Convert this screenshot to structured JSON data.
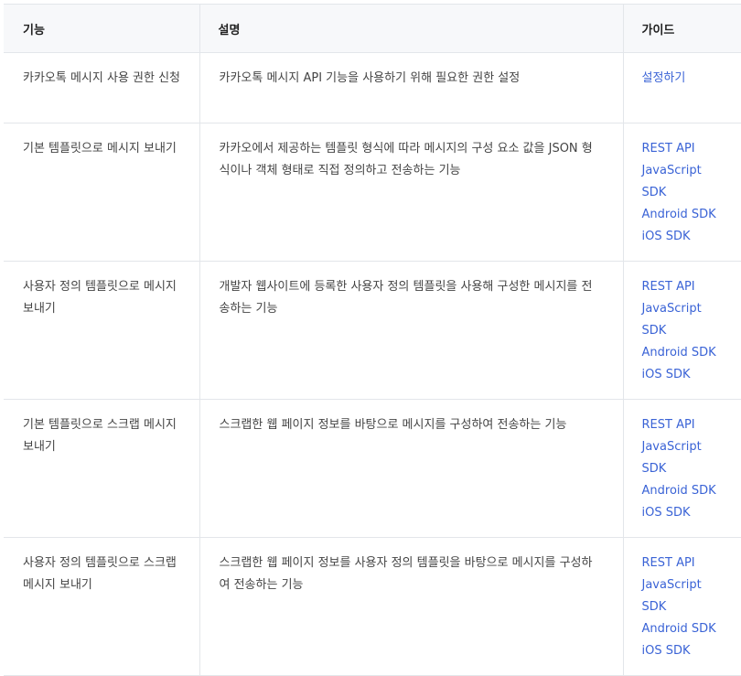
{
  "header": {
    "col1": "기능",
    "col2": "설명",
    "col3": "가이드"
  },
  "rows": [
    {
      "feature": "카카오톡 메시지 사용 권한 신청",
      "description": "카카오톡 메시지 API 기능을 사용하기 위해 필요한 권한 설정",
      "links": [
        "설정하기"
      ]
    },
    {
      "feature": "기본 템플릿으로 메시지 보내기",
      "description": "카카오에서 제공하는 템플릿 형식에 따라 메시지의 구성 요소 값을 JSON 형식이나 객체 형태로 직접 정의하고 전송하는 기능",
      "links": [
        "REST API",
        "JavaScript SDK",
        "Android SDK",
        "iOS SDK"
      ]
    },
    {
      "feature": "사용자 정의 템플릿으로 메시지 보내기",
      "description": "개발자 웹사이트에 등록한 사용자 정의 템플릿을 사용해 구성한 메시지를 전송하는 기능",
      "links": [
        "REST API",
        "JavaScript SDK",
        "Android SDK",
        "iOS SDK"
      ]
    },
    {
      "feature": "기본 템플릿으로 스크랩 메시지 보내기",
      "description": "스크랩한 웹 페이지 정보를 바탕으로 메시지를 구성하여 전송하는 기능",
      "links": [
        "REST API",
        "JavaScript SDK",
        "Android SDK",
        "iOS SDK"
      ]
    },
    {
      "feature": "사용자 정의 템플릿으로 스크랩 메시지 보내기",
      "description": "스크랩한 웹 페이지 정보를 사용자 정의 템플릿을 바탕으로 메시지를 구성하여 전송하는 기능",
      "links": [
        "REST API",
        "JavaScript SDK",
        "Android SDK",
        "iOS SDK"
      ]
    }
  ],
  "colors": {
    "link": "#3a63d6",
    "header_bg": "#f7f8fa",
    "border": "#e3e6ea",
    "text": "#444444"
  }
}
